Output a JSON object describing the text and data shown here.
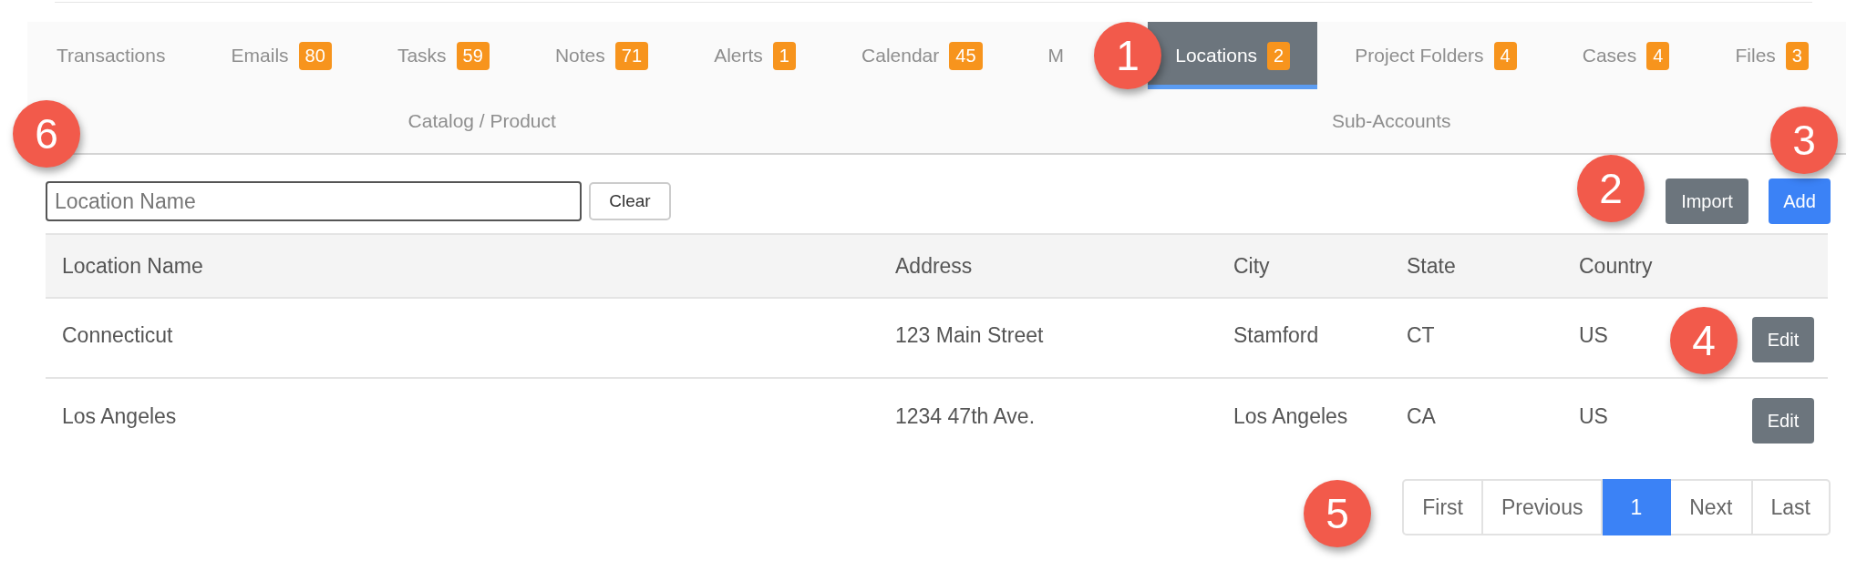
{
  "tabs": [
    {
      "label": "Transactions",
      "selected": false
    },
    {
      "label": "Emails",
      "badge": "80",
      "selected": false
    },
    {
      "label": "Tasks",
      "badge": "59",
      "selected": false
    },
    {
      "label": "Notes",
      "badge": "71",
      "selected": false
    },
    {
      "label": "Alerts",
      "badge": "1",
      "selected": false
    },
    {
      "label": "Calendar",
      "badge": "45",
      "selected": false
    },
    {
      "label": "M",
      "selected": false
    },
    {
      "label": "Locations",
      "badge": "2",
      "selected": true
    },
    {
      "label": "Project Folders",
      "badge": "4",
      "selected": false
    },
    {
      "label": "Cases",
      "badge": "4",
      "selected": false
    },
    {
      "label": "Files",
      "badge": "3",
      "selected": false
    }
  ],
  "tabs_row_2": [
    {
      "label": "Catalog / Product",
      "selected": false
    },
    {
      "label": "Sub-Accounts",
      "selected": false
    }
  ],
  "search": {
    "placeholder": "Location Name"
  },
  "clear_button": "Clear",
  "import_button": "Import",
  "add_button": "Add",
  "table": {
    "columns": [
      "Location Name",
      "Address",
      "City",
      "State",
      "Country"
    ],
    "rows": [
      {
        "cells": [
          "Connecticut",
          "123 Main Street",
          "Stamford",
          "CT",
          "US"
        ],
        "action": "Edit"
      },
      {
        "cells": [
          "Los Angeles",
          "1234 47th Ave.",
          "Los Angeles",
          "CA",
          "US"
        ],
        "action": "Edit"
      }
    ]
  },
  "pagination": [
    {
      "label": "First",
      "selected": false
    },
    {
      "label": "Previous",
      "selected": false
    },
    {
      "label": "1",
      "selected": true
    },
    {
      "label": "Next",
      "selected": false
    },
    {
      "label": "Last",
      "selected": false
    }
  ],
  "callouts": [
    "1",
    "2",
    "3",
    "4",
    "5",
    "6"
  ]
}
